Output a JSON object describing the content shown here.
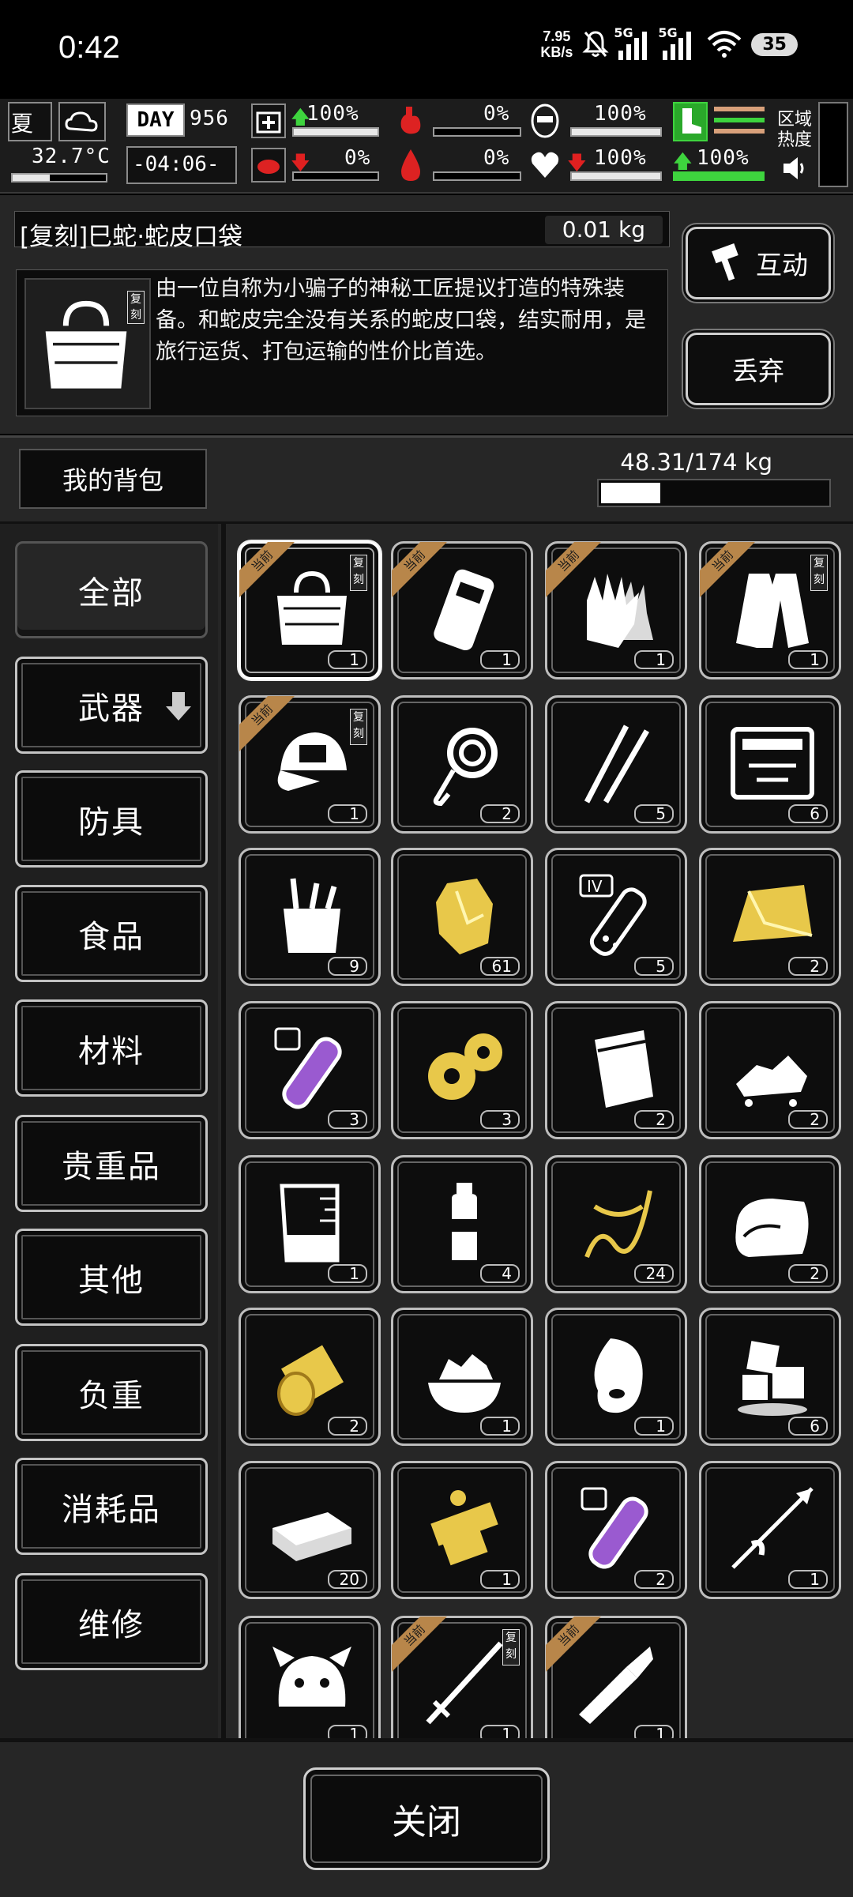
{
  "status_bar": {
    "time": "0:42",
    "net_speed_value": "7.95",
    "net_speed_unit": "KB/s",
    "sim1": "5G",
    "sim2": "5G",
    "battery": "35"
  },
  "hud": {
    "temperature": "32.7°C",
    "day_label": "DAY",
    "day": "956",
    "clock": "-04:06-",
    "health_pct": "100%",
    "injury_pct": "0%",
    "hunger_pct": "0%",
    "thirst_pct": "0%",
    "armor_pct": "100%",
    "heart_pct": "100%",
    "stamina_pct": "100%",
    "region_heat": "区域热度"
  },
  "item": {
    "name": "[复刻]巳蛇·蛇皮口袋",
    "weight": "0.01 kg",
    "description": "由一位自称为小骗子的神秘工匠提议打造的特殊装备。和蛇皮完全没有关系的蛇皮口袋，结实耐用，是旅行运货、打包运输的性价比首选。",
    "replica_badge": "复刻",
    "interact_label": "互动",
    "discard_label": "丢弃"
  },
  "backpack": {
    "title": "我的背包",
    "capacity": "48.31/174 kg",
    "fill_fraction": 0.278
  },
  "categories": [
    "全部",
    "武器",
    "防具",
    "食品",
    "材料",
    "贵重品",
    "其他",
    "负重",
    "消耗品",
    "维修"
  ],
  "equipped_ribbon": "当前",
  "replica_tag": "复刻",
  "items": [
    {
      "icon": "bag-icon",
      "count": "1",
      "equipped": true,
      "replica": true,
      "selected": true
    },
    {
      "icon": "backpack-icon",
      "count": "1",
      "equipped": true
    },
    {
      "icon": "gloves-icon",
      "count": "1",
      "equipped": true
    },
    {
      "icon": "coat-icon",
      "count": "1",
      "equipped": true,
      "replica": true
    },
    {
      "icon": "cap-icon",
      "count": "1",
      "equipped": true,
      "replica": true
    },
    {
      "icon": "rope-icon",
      "count": "2"
    },
    {
      "icon": "tweezers-icon",
      "count": "5"
    },
    {
      "icon": "toolbox-icon",
      "count": "6"
    },
    {
      "icon": "tool-bag-icon",
      "count": "9"
    },
    {
      "icon": "gold-ore-icon",
      "count": "61"
    },
    {
      "icon": "test-tube-iv-icon",
      "count": "5",
      "tube_label": "IV"
    },
    {
      "icon": "gold-bar-icon",
      "count": "2"
    },
    {
      "icon": "purple-tube-icon",
      "count": "3"
    },
    {
      "icon": "gears-icon",
      "count": "3"
    },
    {
      "icon": "pouch-icon",
      "count": "2"
    },
    {
      "icon": "rubble-icon",
      "count": "2"
    },
    {
      "icon": "beaker-icon",
      "count": "1"
    },
    {
      "icon": "water-bottle-icon",
      "count": "4"
    },
    {
      "icon": "wire-icon",
      "count": "24"
    },
    {
      "icon": "cloth-icon",
      "count": "2"
    },
    {
      "icon": "cable-spool-icon",
      "count": "2"
    },
    {
      "icon": "rice-bowl-icon",
      "count": "1"
    },
    {
      "icon": "meat-icon",
      "count": "1"
    },
    {
      "icon": "ice-icon",
      "count": "6"
    },
    {
      "icon": "cash-icon",
      "count": "20"
    },
    {
      "icon": "gold-parts-icon",
      "count": "1"
    },
    {
      "icon": "purple-tube-2-icon",
      "count": "2"
    },
    {
      "icon": "spear-icon",
      "count": "1"
    },
    {
      "icon": "tiger-hat-icon",
      "count": "1"
    },
    {
      "icon": "sword-icon",
      "count": "1",
      "equipped": true,
      "replica": true
    },
    {
      "icon": "knife-icon",
      "count": "1",
      "equipped": true
    }
  ],
  "close_label": "关闭"
}
